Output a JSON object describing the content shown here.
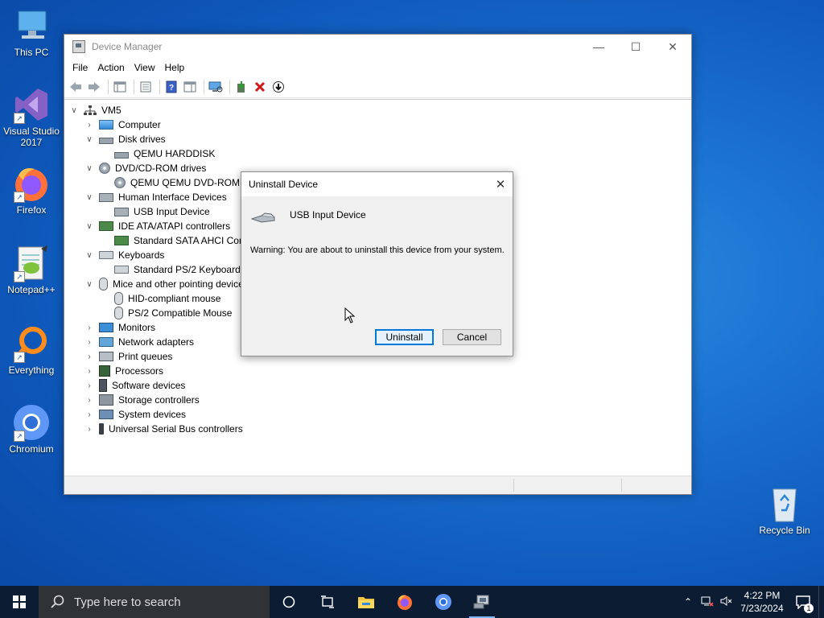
{
  "desktop": {
    "icons": [
      {
        "label": "This PC"
      },
      {
        "label": "Visual Studio 2017"
      },
      {
        "label": "Firefox"
      },
      {
        "label": "Notepad++"
      },
      {
        "label": "Everything"
      },
      {
        "label": "Chromium"
      },
      {
        "label": "Recycle Bin"
      }
    ]
  },
  "window": {
    "title": "Device Manager",
    "menu": [
      "File",
      "Action",
      "View",
      "Help"
    ],
    "tree": {
      "root": "VM5",
      "nodes": [
        {
          "label": "Computer",
          "level": 1,
          "expanded": false
        },
        {
          "label": "Disk drives",
          "level": 1,
          "expanded": true
        },
        {
          "label": "QEMU HARDDISK",
          "level": 2
        },
        {
          "label": "DVD/CD-ROM drives",
          "level": 1,
          "expanded": true
        },
        {
          "label": "QEMU QEMU DVD-ROM",
          "level": 2
        },
        {
          "label": "Human Interface Devices",
          "level": 1,
          "expanded": true
        },
        {
          "label": "USB Input Device",
          "level": 2
        },
        {
          "label": "IDE ATA/ATAPI controllers",
          "level": 1,
          "expanded": true
        },
        {
          "label": "Standard SATA AHCI Controller",
          "level": 2
        },
        {
          "label": "Keyboards",
          "level": 1,
          "expanded": true
        },
        {
          "label": "Standard PS/2 Keyboard",
          "level": 2
        },
        {
          "label": "Mice and other pointing devices",
          "level": 1,
          "expanded": true
        },
        {
          "label": "HID-compliant mouse",
          "level": 2
        },
        {
          "label": "PS/2 Compatible Mouse",
          "level": 2
        },
        {
          "label": "Monitors",
          "level": 1,
          "expanded": false
        },
        {
          "label": "Network adapters",
          "level": 1,
          "expanded": false
        },
        {
          "label": "Print queues",
          "level": 1,
          "expanded": false
        },
        {
          "label": "Processors",
          "level": 1,
          "expanded": false
        },
        {
          "label": "Software devices",
          "level": 1,
          "expanded": false
        },
        {
          "label": "Storage controllers",
          "level": 1,
          "expanded": false
        },
        {
          "label": "System devices",
          "level": 1,
          "expanded": false
        },
        {
          "label": "Universal Serial Bus controllers",
          "level": 1,
          "expanded": false
        }
      ]
    }
  },
  "dialog": {
    "title": "Uninstall Device",
    "device_name": "USB Input Device",
    "warning": "Warning: You are about to uninstall this device from your system.",
    "uninstall_label": "Uninstall",
    "cancel_label": "Cancel"
  },
  "taskbar": {
    "search_placeholder": "Type here to search",
    "time": "4:22 PM",
    "date": "7/23/2024",
    "notification_count": "1"
  }
}
